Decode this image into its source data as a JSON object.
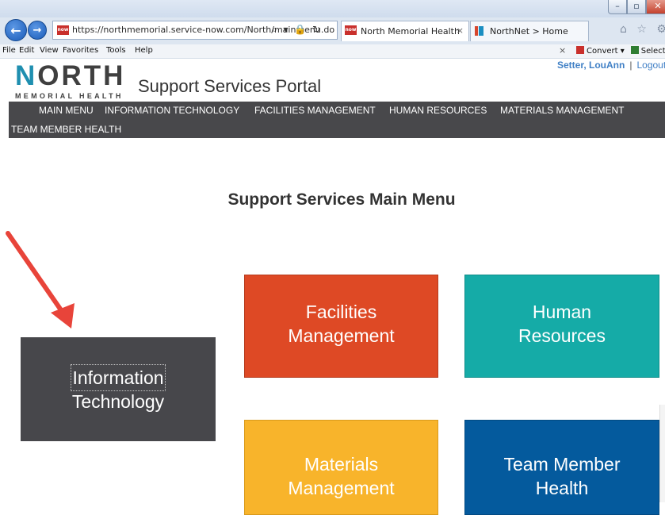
{
  "browser": {
    "url": "https://northmemorial.service-now.com/North/mainmenu.do",
    "url_icons": "⌕ ▾ 🔒 ↻",
    "favicon_label": "now",
    "tabs": [
      {
        "label": "North Memorial Health",
        "close": "×"
      },
      {
        "label": "NorthNet > Home"
      }
    ],
    "right_icons": "⌂ ☆ ⚙",
    "window_buttons": {
      "minimize": "–",
      "maximize": "▫",
      "close": "✕"
    },
    "back": "←",
    "forward": "→"
  },
  "menubar": {
    "items": [
      "File",
      "Edit",
      "View",
      "Favorites",
      "Tools",
      "Help"
    ],
    "close": "×",
    "convert": "Convert",
    "convert_caret": "▾",
    "select": "Select"
  },
  "header": {
    "logo_main_first": "N",
    "logo_main_rest": "ORTH",
    "logo_sub": "MEMORIAL HEALTH",
    "portal_title": "Support Services Portal",
    "user_name": "Setter, LouAnn",
    "separator": "|",
    "logout": "Logout"
  },
  "nav": {
    "items": [
      "MAIN MENU",
      "INFORMATION TECHNOLOGY",
      "FACILITIES MANAGEMENT",
      "HUMAN RESOURCES",
      "MATERIALS MANAGEMENT",
      "TEAM MEMBER HEALTH"
    ]
  },
  "main": {
    "heading": "Support Services Main Menu",
    "tiles": {
      "it": {
        "line1": "Information",
        "line2": "Technology",
        "color": "#47474b"
      },
      "facilities": {
        "line1": "Facilities",
        "line2": "Management",
        "color": "#de4925"
      },
      "hr": {
        "line1": "Human",
        "line2": "Resources",
        "color": "#15aba7"
      },
      "materials": {
        "line1": "Materials",
        "line2": "Management",
        "color": "#f8b42b"
      },
      "team_health": {
        "line1": "Team Member",
        "line2": "Health",
        "color": "#045a9d"
      }
    }
  },
  "annotation": {
    "arrow_color": "#e8443a"
  }
}
